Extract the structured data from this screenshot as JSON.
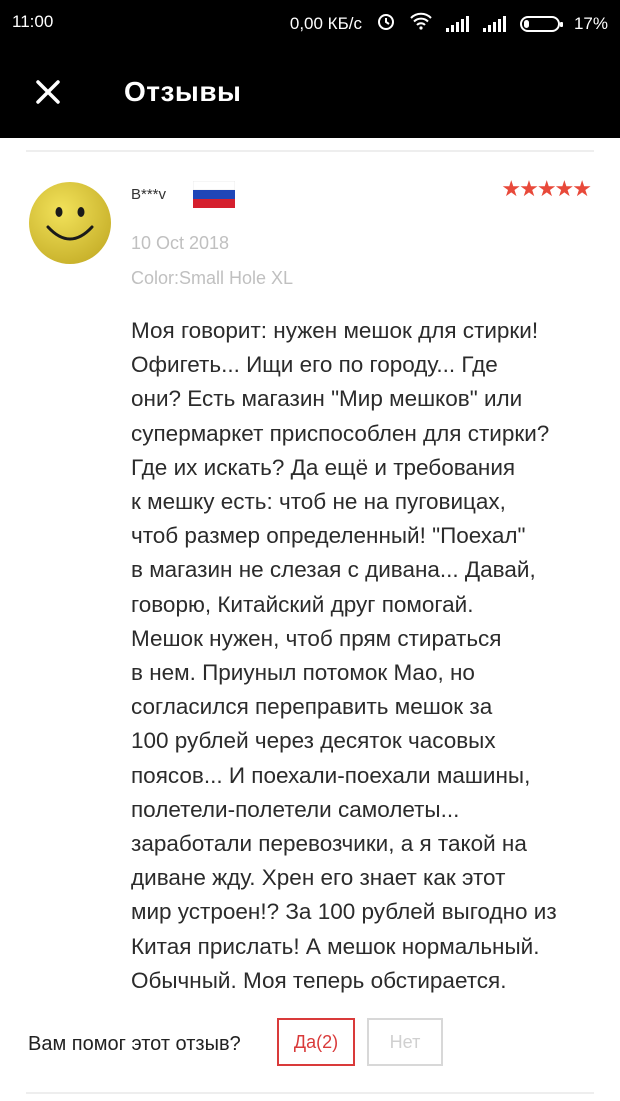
{
  "status_bar": {
    "time": "11:00",
    "net_speed": "0,00 КБ/с",
    "battery": "17%",
    "battery_level": 0.17
  },
  "header": {
    "title": "Отзывы",
    "close_icon": "close-icon"
  },
  "review": {
    "author": "B***v",
    "country_flag_icon": "russia-flag-icon",
    "rating": 5,
    "stars": "★★★★★",
    "date": "10 Oct 2018",
    "variant": "Color:Small Hole XL",
    "text_lines": [
      "Моя говорит: нужен мешок для стирки!",
      "Офигеть... Ищи его по городу... Где",
      "они? Есть магазин \"Мир мешков\" или",
      "супермаркет приспособлен для стирки?",
      "Где их искать? Да ещё и требования",
      "к мешку есть: чтоб не на пуговицах,",
      "чтоб размер определенный! \"Поехал\"",
      "в магазин не слезая с дивана... Давай,",
      "говорю, Китайский друг помогай.",
      "Мешок нужен, чтоб прям стираться",
      "в нем. Приуныл потомок Мао, но",
      "согласился переправить мешок за",
      "100 рублей через десяток часовых",
      "поясов... И поехали-поехали машины,",
      "полетели-полетели самолеты...",
      "заработали перевозчики, а я такой на",
      "диване жду. Хрен его знает как этот",
      "мир устроен!? За 100 рублей выгодно из",
      "Китая прислать! А мешок нормальный.",
      "Обычный. Моя теперь обстирается."
    ]
  },
  "helpful": {
    "question": "Вам помог этот отзыв?",
    "yes_label": "Да(2)",
    "no_label": "Нет"
  },
  "colors": {
    "accent_red": "#d93a3a",
    "star_red": "#e8493a",
    "muted_gray": "#c0c0c0"
  }
}
